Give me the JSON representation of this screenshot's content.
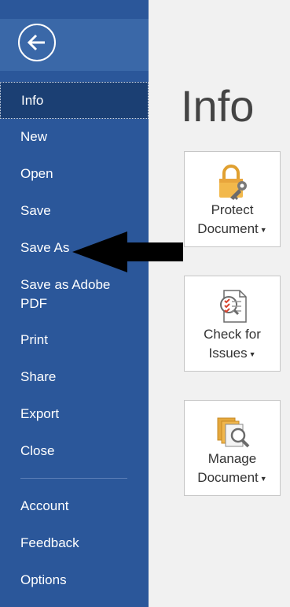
{
  "sidebar": {
    "back_icon": "back-arrow-icon",
    "items": [
      {
        "label": "Info"
      },
      {
        "label": "New"
      },
      {
        "label": "Open"
      },
      {
        "label": "Save"
      },
      {
        "label": "Save As"
      },
      {
        "label": "Save as Adobe PDF"
      },
      {
        "label": "Print"
      },
      {
        "label": "Share"
      },
      {
        "label": "Export"
      },
      {
        "label": "Close"
      },
      {
        "label": "Account"
      },
      {
        "label": "Feedback"
      },
      {
        "label": "Options"
      }
    ],
    "active": "Info"
  },
  "main": {
    "title": "Info",
    "cards": [
      {
        "line1": "Protect",
        "line2": "Document",
        "icon": "lock-key-icon"
      },
      {
        "line1": "Check for",
        "line2": "Issues",
        "icon": "inspect-document-icon"
      },
      {
        "line1": "Manage",
        "line2": "Document",
        "icon": "manage-versions-icon"
      }
    ]
  },
  "colors": {
    "sidebar": "#2b579a",
    "active_item": "#1b3f73",
    "canvas": "#f1f1f1"
  }
}
